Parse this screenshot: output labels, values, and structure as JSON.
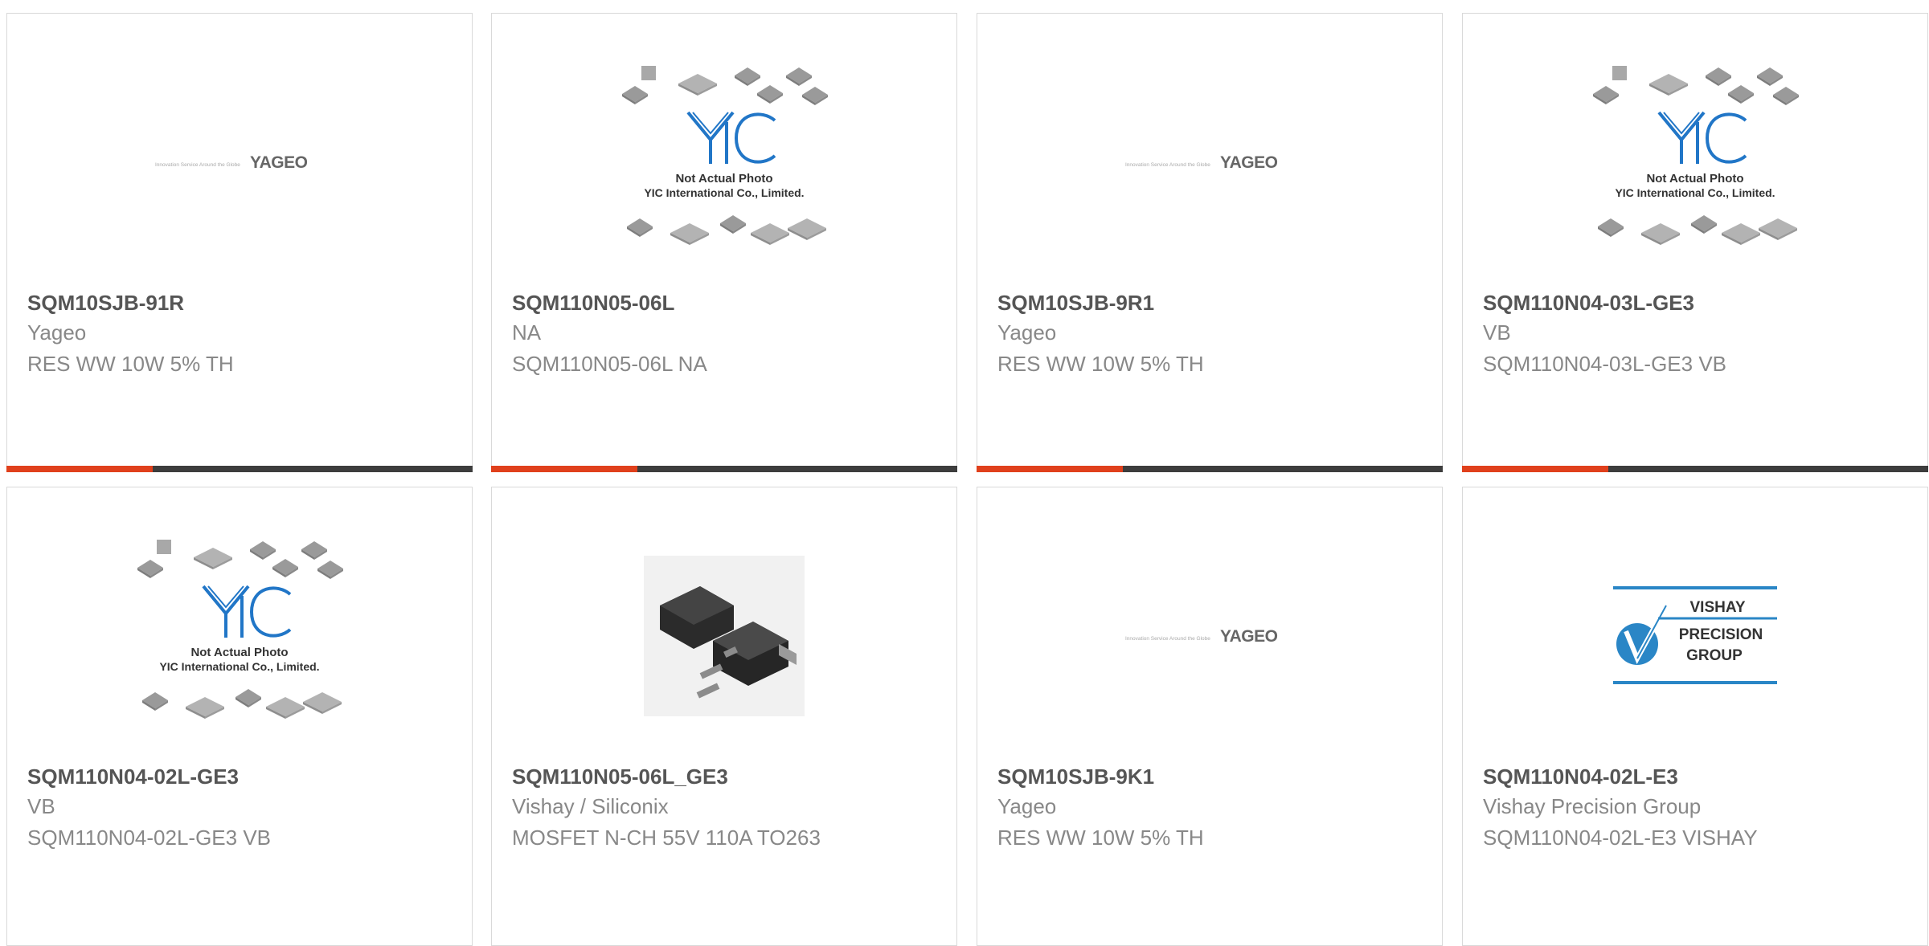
{
  "colors": {
    "accent": "#e0401c",
    "bar_dark": "#3d3d3d",
    "title": "#555555",
    "text": "#888888",
    "border": "#d9d9d9",
    "yic_blue": "#2176c7",
    "vishay_blue": "#2a86c6"
  },
  "products": [
    {
      "part": "SQM10SJB-91R",
      "manufacturer": "Yageo",
      "description": "RES WW 10W 5% TH",
      "image": "yageo-logo"
    },
    {
      "part": "SQM110N05-06L",
      "manufacturer": "NA",
      "description": "SQM110N05-06L NA",
      "image": "yic-not-actual-photo"
    },
    {
      "part": "SQM10SJB-9R1",
      "manufacturer": "Yageo",
      "description": "RES WW 10W 5% TH",
      "image": "yageo-logo"
    },
    {
      "part": "SQM110N04-03L-GE3",
      "manufacturer": "VB",
      "description": "SQM110N04-03L-GE3 VB",
      "image": "yic-not-actual-photo"
    },
    {
      "part": "SQM110N04-02L-GE3",
      "manufacturer": "VB",
      "description": "SQM110N04-02L-GE3 VB",
      "image": "yic-not-actual-photo"
    },
    {
      "part": "SQM110N05-06L_GE3",
      "manufacturer": "Vishay / Siliconix",
      "description": "MOSFET N-CH 55V 110A TO263",
      "image": "to263-package-photo"
    },
    {
      "part": "SQM10SJB-9K1",
      "manufacturer": "Yageo",
      "description": "RES WW 10W 5% TH",
      "image": "yageo-logo"
    },
    {
      "part": "SQM110N04-02L-E3",
      "manufacturer": "Vishay Precision Group",
      "description": "SQM110N04-02L-E3 VISHAY",
      "image": "vishay-precision-group-logo"
    }
  ],
  "logos": {
    "yageo": {
      "tagline": "Innovation Service Around the Globe",
      "name": "YAGEO"
    },
    "yic": {
      "mark": "YIC",
      "line1": "Not Actual Photo",
      "line2": "YIC International Co., Limited."
    },
    "vishay": {
      "line1": "VISHAY",
      "line2": "PRECISION",
      "line3": "GROUP"
    }
  }
}
